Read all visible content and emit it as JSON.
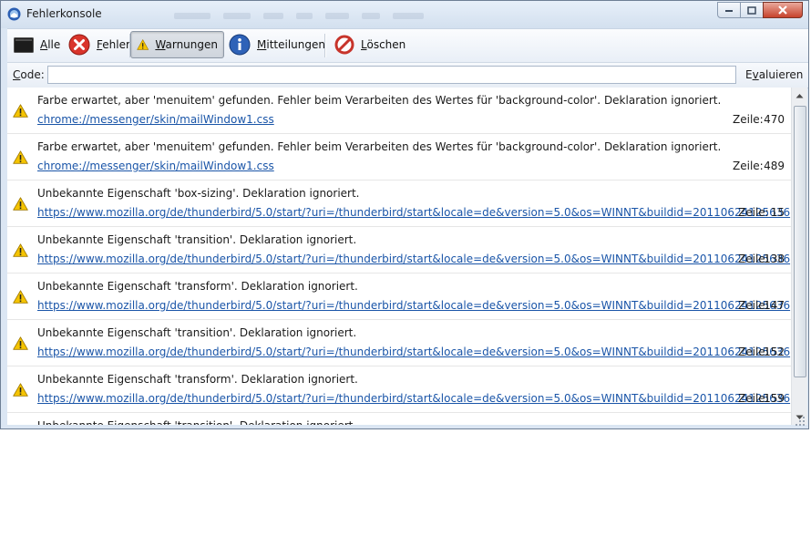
{
  "window": {
    "title": "Fehlerkonsole"
  },
  "toolbar": {
    "all": {
      "label_u": "A",
      "label_rest": "lle"
    },
    "errors": {
      "label_u": "F",
      "label_rest": "ehler"
    },
    "warnings": {
      "label_u": "W",
      "label_rest": "arnungen"
    },
    "messages": {
      "label_u": "M",
      "label_rest": "itteilungen"
    },
    "clear": {
      "label_u": "L",
      "label_rest": "öschen"
    }
  },
  "code": {
    "label_u": "C",
    "label_rest": "ode:",
    "value": "",
    "evaluate_pre": "E",
    "evaluate_u": "v",
    "evaluate_rest": "aluieren"
  },
  "line_label": "Zeile:",
  "entries": [
    {
      "message": "Farbe erwartet, aber 'menuitem' gefunden.  Fehler beim Verarbeiten des Wertes für 'background-color'.  Deklaration ignoriert.",
      "source": "chrome://messenger/skin/mailWindow1.css",
      "line": "470"
    },
    {
      "message": "Farbe erwartet, aber 'menuitem' gefunden.  Fehler beim Verarbeiten des Wertes für 'background-color'.  Deklaration ignoriert.",
      "source": "chrome://messenger/skin/mailWindow1.css",
      "line": "489"
    },
    {
      "message": "Unbekannte Eigenschaft 'box-sizing'.  Deklaration ignoriert.",
      "source": "https://www.mozilla.org/de/thunderbird/5.0/start/?uri=/thunderbird/start&locale=de&version=5.0&os=WINNT&buildid=20110624125636",
      "line": "15"
    },
    {
      "message": "Unbekannte Eigenschaft 'transition'.  Deklaration ignoriert.",
      "source": "https://www.mozilla.org/de/thunderbird/5.0/start/?uri=/thunderbird/start&locale=de&version=5.0&os=WINNT&buildid=20110624125636",
      "line": "138"
    },
    {
      "message": "Unbekannte Eigenschaft 'transform'.  Deklaration ignoriert.",
      "source": "https://www.mozilla.org/de/thunderbird/5.0/start/?uri=/thunderbird/start&locale=de&version=5.0&os=WINNT&buildid=20110624125636",
      "line": "147"
    },
    {
      "message": "Unbekannte Eigenschaft 'transition'.  Deklaration ignoriert.",
      "source": "https://www.mozilla.org/de/thunderbird/5.0/start/?uri=/thunderbird/start&locale=de&version=5.0&os=WINNT&buildid=20110624125636",
      "line": "152"
    },
    {
      "message": "Unbekannte Eigenschaft 'transform'.  Deklaration ignoriert.",
      "source": "https://www.mozilla.org/de/thunderbird/5.0/start/?uri=/thunderbird/start&locale=de&version=5.0&os=WINNT&buildid=20110624125636",
      "line": "159"
    },
    {
      "message": "Unbekannte Eigenschaft 'transition'.  Deklaration ignoriert.",
      "source": "",
      "line": ""
    }
  ],
  "colors": {
    "link": "#1a55a8",
    "warning_fill": "#f5c400",
    "error_fill": "#d9342b",
    "info_fill": "#2e62b8"
  },
  "icons": {
    "all": "console-icon",
    "errors": "error-icon",
    "warnings": "warning-icon",
    "messages": "info-icon",
    "clear": "clear-icon",
    "entry": "warning-icon"
  }
}
